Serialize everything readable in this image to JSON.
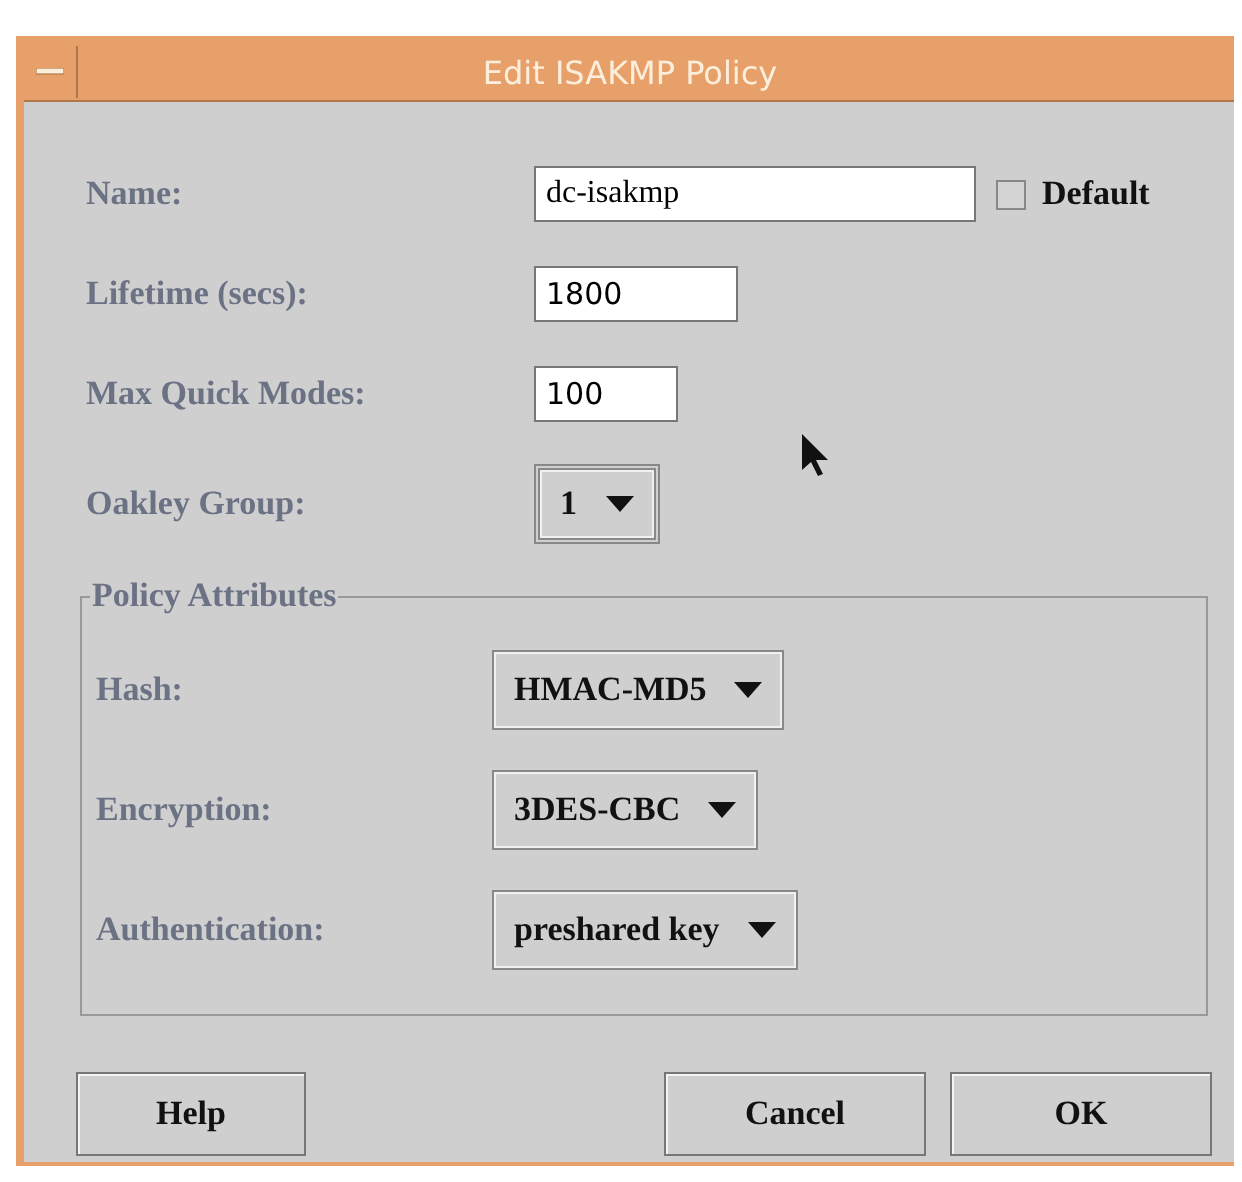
{
  "window": {
    "title": "Edit ISAKMP Policy"
  },
  "fields": [
    {
      "kind": "text",
      "label": "Name:",
      "value": "dc-isakmp",
      "checkbox": {
        "label": "Default",
        "checked": false
      }
    },
    {
      "kind": "text",
      "label": "Lifetime (secs):",
      "value": "1800"
    },
    {
      "kind": "text",
      "label": "Max Quick Modes:",
      "value": "100"
    },
    {
      "kind": "dropdown",
      "label": "Oakley Group:",
      "value": "1"
    }
  ],
  "policy_attributes": {
    "title": "Policy Attributes",
    "fields": [
      {
        "kind": "dropdown",
        "label": "Hash:",
        "value": "HMAC-MD5"
      },
      {
        "kind": "dropdown",
        "label": "Encryption:",
        "value": "3DES-CBC"
      },
      {
        "kind": "dropdown",
        "label": "Authentication:",
        "value": "preshared key"
      }
    ]
  },
  "buttons": [
    {
      "label": "Help",
      "kind": "left"
    },
    {
      "label": "Cancel",
      "kind": "right"
    },
    {
      "label": "OK",
      "kind": "right"
    }
  ]
}
